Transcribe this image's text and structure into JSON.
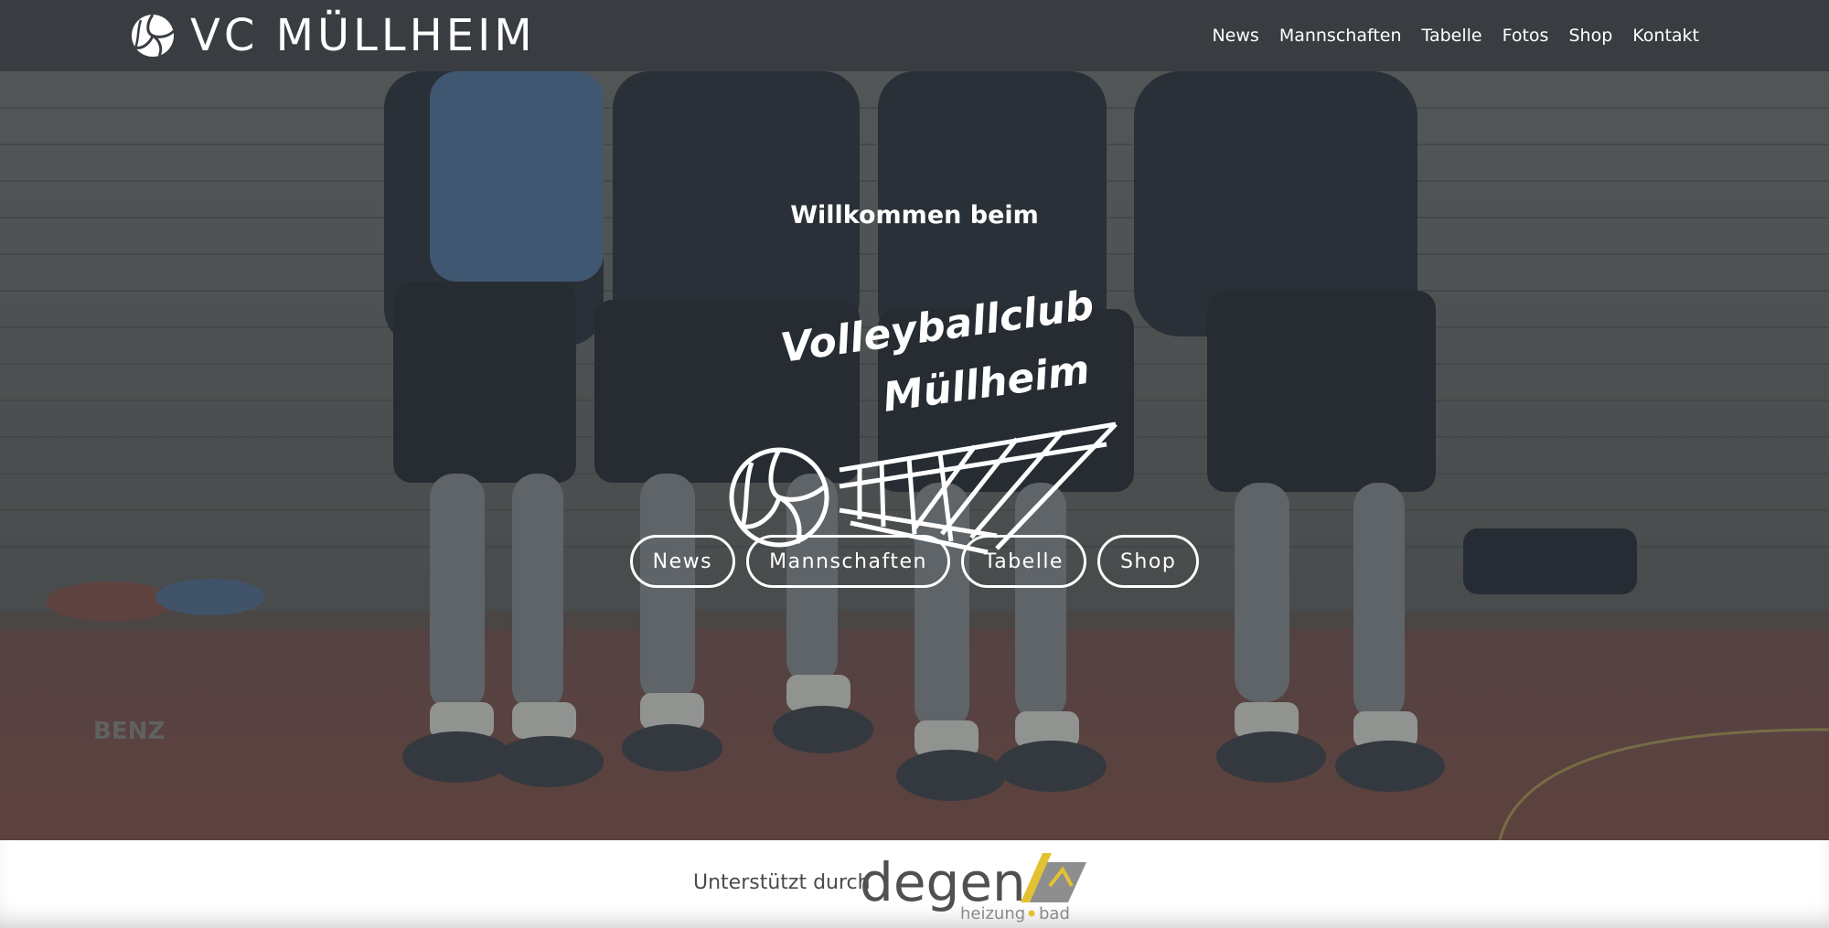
{
  "header": {
    "brand": "VC MÜLLHEIM",
    "brand_icon": "volleyball-icon",
    "nav": [
      "News",
      "Mannschaften",
      "Tabelle",
      "Fotos",
      "Shop",
      "Kontakt"
    ]
  },
  "hero": {
    "welcome": "Willkommen beim",
    "logo_line1": "Volleyballclub",
    "logo_line2": "Müllheim",
    "buttons": [
      "News",
      "Mannschaften",
      "Tabelle",
      "Shop"
    ],
    "bg_sign": "BENZ"
  },
  "sponsor": {
    "label": "Unterstützt durch",
    "logo_word": "degen",
    "logo_sub_left": "heizung",
    "logo_sub_right": "bad"
  },
  "colors": {
    "header_bg": "#393d42",
    "accent_yellow": "#e2c233",
    "text_white": "#ffffff"
  }
}
